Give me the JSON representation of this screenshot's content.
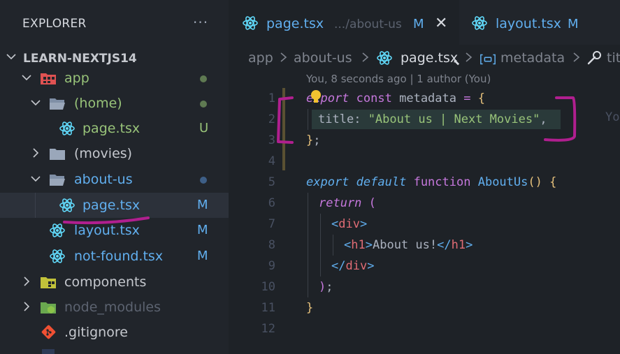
{
  "explorer": {
    "title": "EXPLORER",
    "more": "···",
    "project": "LEARN-NEXTJS14",
    "tree": [
      {
        "label": "app",
        "status": ""
      },
      {
        "label": "(home)",
        "status": ""
      },
      {
        "label": "page.tsx",
        "status": "U"
      },
      {
        "label": "(movies)",
        "status": ""
      },
      {
        "label": "about-us",
        "status": ""
      },
      {
        "label": "page.tsx",
        "status": "M"
      },
      {
        "label": "layout.tsx",
        "status": "M"
      },
      {
        "label": "not-found.tsx",
        "status": "M"
      },
      {
        "label": "components",
        "status": ""
      },
      {
        "label": "node_modules",
        "status": ""
      },
      {
        "label": ".gitignore",
        "status": ""
      }
    ]
  },
  "tabs": [
    {
      "name": "page.tsx",
      "path": ".../about-us",
      "status": "M",
      "close": "✕"
    },
    {
      "name": "layout.tsx",
      "status": "M"
    }
  ],
  "breadcrumb": [
    "app",
    "about-us",
    "page.tsx",
    "metadata",
    "titl"
  ],
  "codelens": "You, 8 seconds ago | 1 author (You)",
  "ghost_text": "Yo",
  "line_numbers": [
    "1",
    "2",
    "3",
    "4",
    "5",
    "6",
    "7",
    "8",
    "9",
    "10",
    "11",
    "12"
  ],
  "code": {
    "l1": {
      "kw1": "export",
      "kw2": "const",
      "name": "metadata",
      "op": "=",
      "open": "{"
    },
    "l2": {
      "prop": "title",
      "colon": ":",
      "value": "\"About us | Next Movies\"",
      "comma": ","
    },
    "l3": {
      "close": "}",
      "semi": ";"
    },
    "l5": {
      "kw1": "export",
      "kw2": "default",
      "kw3": "function",
      "name": "AboutUs",
      "paren": "()",
      "open": "{"
    },
    "l6": {
      "kw": "return",
      "paren": "("
    },
    "l7": {
      "lt": "<",
      "tag": "div",
      "gt": ">"
    },
    "l8": {
      "lt": "<",
      "tag": "h1",
      "gt": ">",
      "text": "About us!",
      "lt2": "</",
      "tag2": "h1",
      "gt2": ">"
    },
    "l9": {
      "lt": "</",
      "tag": "div",
      "gt": ">"
    },
    "l10": {
      "paren": ")",
      "semi": ";"
    },
    "l11": {
      "close": "}"
    }
  },
  "colors": {
    "react": "#61dafb",
    "modified": "#61afef",
    "untracked": "#98c379",
    "annotation": "#b01f8f",
    "folder": "#7f8fa6",
    "app_folder": "#e05252",
    "components_folder": "#c2c23a",
    "node_modules_folder": "#8bc34a",
    "git": "#f05033"
  }
}
